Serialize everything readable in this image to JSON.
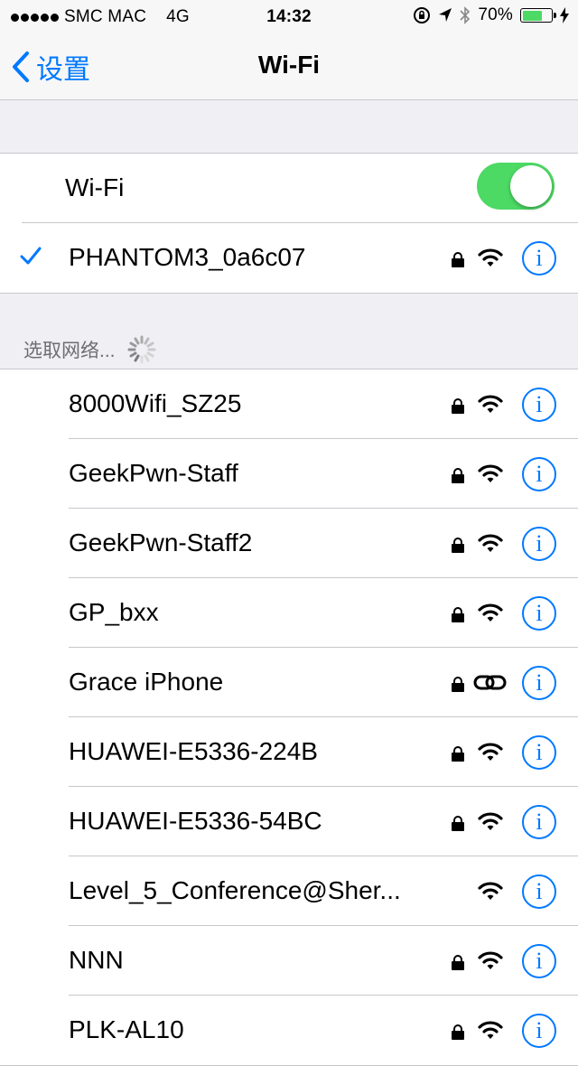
{
  "status_bar": {
    "carrier": "SMC MAC",
    "network": "4G",
    "time": "14:32",
    "battery_percent": "70%",
    "battery_level": 0.7
  },
  "nav": {
    "back_label": "设置",
    "title": "Wi-Fi"
  },
  "wifi_toggle": {
    "label": "Wi-Fi",
    "on": true
  },
  "connected": {
    "name": "PHANTOM3_0a6c07",
    "secured": true
  },
  "choose_network": {
    "header": "选取网络..."
  },
  "networks": [
    {
      "name": "8000Wifi_SZ25",
      "secured": true,
      "icon": "wifi-icon"
    },
    {
      "name": "GeekPwn-Staff",
      "secured": true,
      "icon": "wifi-icon"
    },
    {
      "name": "GeekPwn-Staff2",
      "secured": true,
      "icon": "wifi-icon"
    },
    {
      "name": "GP_bxx",
      "secured": true,
      "icon": "wifi-icon"
    },
    {
      "name": "Grace iPhone",
      "secured": true,
      "icon": "hotspot-link-icon"
    },
    {
      "name": "HUAWEI-E5336-224B",
      "secured": true,
      "icon": "wifi-icon"
    },
    {
      "name": "HUAWEI-E5336-54BC",
      "secured": true,
      "icon": "wifi-icon"
    },
    {
      "name": "Level_5_Conference@Sher...",
      "secured": false,
      "icon": "wifi-icon"
    },
    {
      "name": "NNN",
      "secured": true,
      "icon": "wifi-icon"
    },
    {
      "name": "PLK-AL10",
      "secured": true,
      "icon": "wifi-icon"
    }
  ],
  "colors": {
    "accent": "#0079ff",
    "toggle_on": "#4cd964",
    "background": "#efeff4"
  }
}
